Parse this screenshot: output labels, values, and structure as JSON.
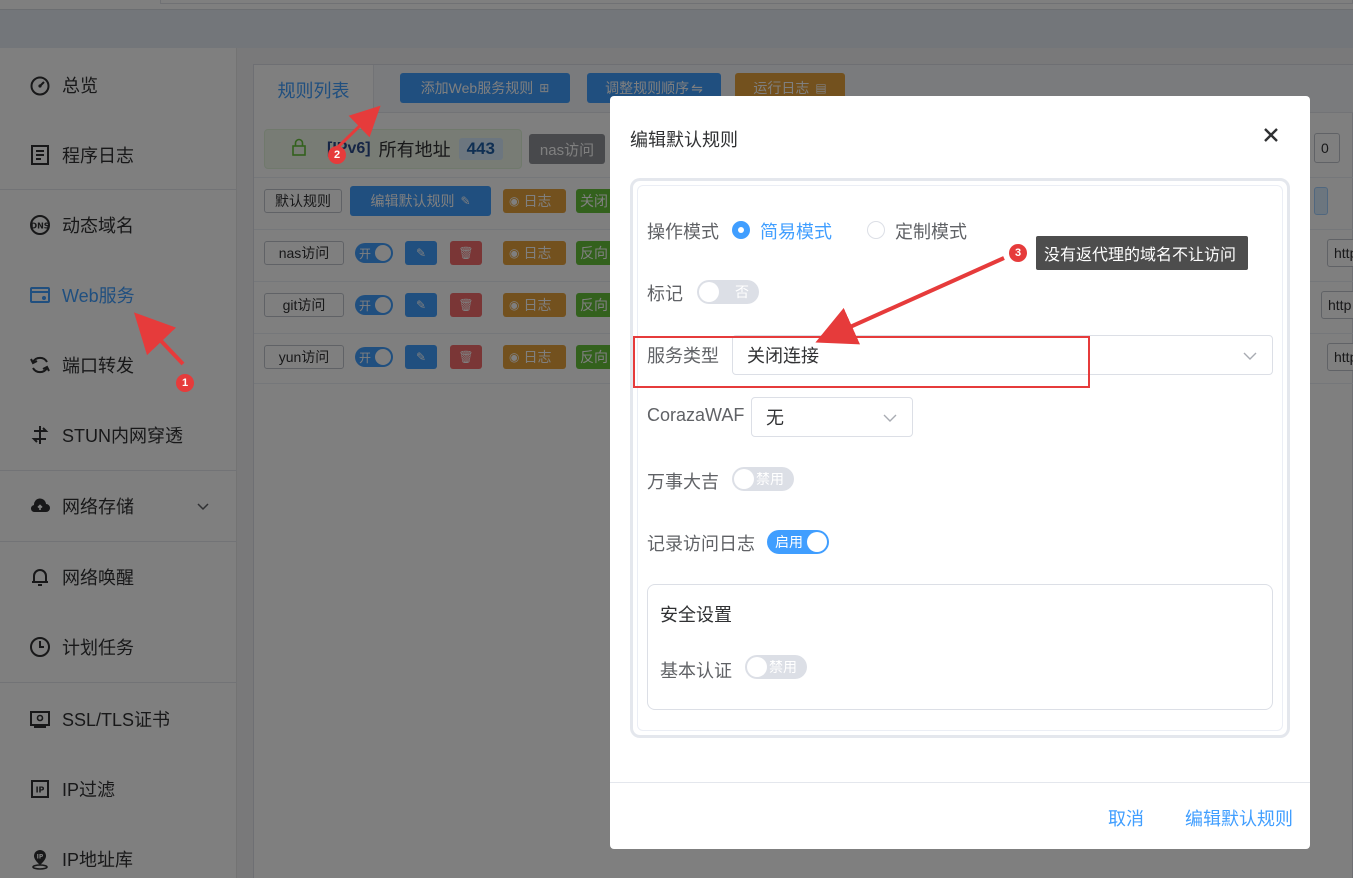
{
  "sidebar": {
    "items": [
      {
        "label": "总览",
        "icon": "dashboard-icon"
      },
      {
        "label": "程序日志",
        "icon": "log-icon"
      },
      {
        "label": "动态域名",
        "icon": "dns-icon"
      },
      {
        "label": "Web服务",
        "icon": "web-service-icon"
      },
      {
        "label": "端口转发",
        "icon": "port-forward-icon"
      },
      {
        "label": "STUN内网穿透",
        "icon": "stun-icon"
      },
      {
        "label": "网络存储",
        "icon": "cloud-icon"
      },
      {
        "label": "网络唤醒",
        "icon": "bell-icon"
      },
      {
        "label": "计划任务",
        "icon": "clock-icon"
      },
      {
        "label": "SSL/TLS证书",
        "icon": "certificate-icon"
      },
      {
        "label": "IP过滤",
        "icon": "ip-filter-icon"
      },
      {
        "label": "IP地址库",
        "icon": "ip-location-icon"
      }
    ],
    "active_color": "#409eff"
  },
  "main": {
    "tab_rules": "规则列表",
    "btn_add": "添加Web服务规则",
    "btn_order": "调整规则顺序",
    "btn_log": "运行日志",
    "ipv6_label": "[IPv6]",
    "all_addresses": "所有地址",
    "port": "443",
    "nas_chip": "nas访问",
    "default_rule": "默认规则",
    "edit_default": "编辑默认规则",
    "log_tag": "日志",
    "close_tag": "关闭",
    "reverse_tag": "反向",
    "switch_on": "开",
    "rows": [
      {
        "name": "nas访问"
      },
      {
        "name": "git访问"
      },
      {
        "name": "yun访问"
      }
    ],
    "right_frag_http": "http",
    "right_frag_zero": "0"
  },
  "dialog": {
    "title": "编辑默认规则",
    "mode_label": "操作模式",
    "mode_simple": "简易模式",
    "mode_custom": "定制模式",
    "mark_label": "标记",
    "mark_value": "否",
    "service_type_label": "服务类型",
    "service_type_value": "关闭连接",
    "waf_label": "CorazaWAF",
    "waf_value": "无",
    "wanshi_label": "万事大吉",
    "wanshi_value": "禁用",
    "access_log_label": "记录访问日志",
    "access_log_value": "启用",
    "security_title": "安全设置",
    "basic_auth_label": "基本认证",
    "basic_auth_value": "禁用",
    "cancel": "取消",
    "confirm": "编辑默认规则"
  },
  "annotations": {
    "tooltip": "没有返代理的域名不让访问",
    "badge1": "1",
    "badge2": "2",
    "badge3": "3",
    "color": "#e63b3b"
  }
}
